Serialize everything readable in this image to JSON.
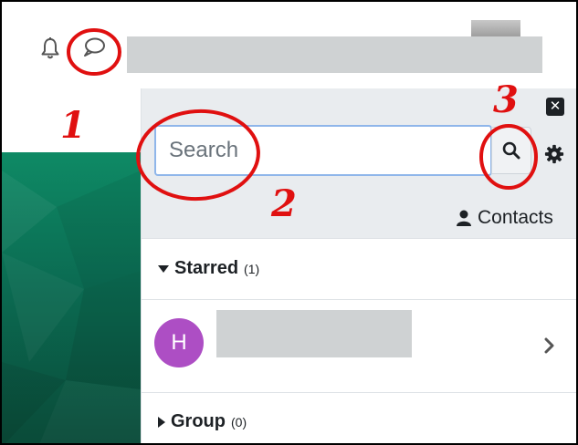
{
  "header": {
    "notifications_icon": "bell-icon",
    "messages_icon": "speech-bubble-icon"
  },
  "drawer": {
    "close_icon": "close-icon",
    "search": {
      "placeholder": "Search",
      "value": ""
    },
    "search_button_icon": "search-icon",
    "settings_icon": "gear-icon",
    "contacts_label": "Contacts",
    "sections": {
      "starred": {
        "label": "Starred",
        "count": "(1)"
      },
      "group": {
        "label": "Group",
        "count": "(0)"
      }
    },
    "starred_conversation": {
      "avatar_initial": "H"
    }
  },
  "annotations": [
    "1",
    "2",
    "3"
  ],
  "colors": {
    "annotation": "#e01010",
    "avatar": "#ad4ec4",
    "panel_green": "#0b6b52",
    "drawer_header": "#e9ecef",
    "redaction": "#cfd2d3"
  }
}
